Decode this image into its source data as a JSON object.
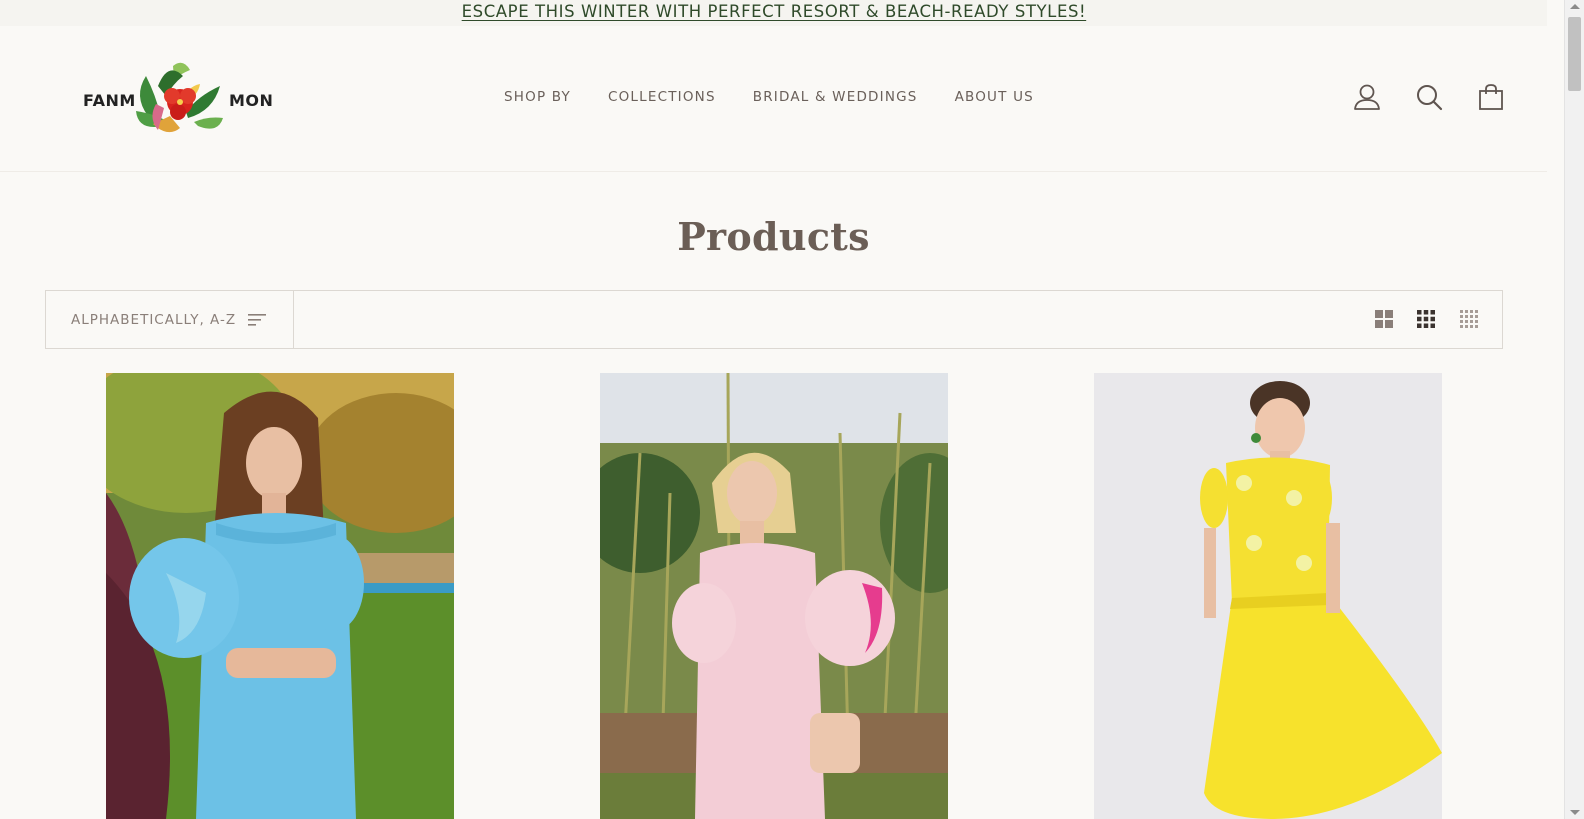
{
  "announcement": {
    "text": "ESCAPE THIS WINTER WITH PERFECT RESORT & BEACH-READY STYLES!"
  },
  "brand": {
    "left": "FANM",
    "right": "MON"
  },
  "nav": [
    {
      "label": "SHOP BY"
    },
    {
      "label": "COLLECTIONS"
    },
    {
      "label": "BRIDAL & WEDDINGS"
    },
    {
      "label": "ABOUT US"
    }
  ],
  "header_icons": [
    "account-icon",
    "search-icon",
    "cart-icon"
  ],
  "page": {
    "title": "Products"
  },
  "toolbar": {
    "sort_label": "ALPHABETICALLY, A-Z",
    "grid_options": [
      "grid-2-icon",
      "grid-3-icon",
      "grid-4-icon"
    ],
    "active_grid": "grid-3-icon"
  },
  "products": [
    {
      "dress_color": "#6cc1e6",
      "description_icon": "blue-dress-photo"
    },
    {
      "dress_color": "#f3cdd6",
      "description_icon": "pink-dress-photo"
    },
    {
      "dress_color": "#f7e22c",
      "description_icon": "yellow-dress-photo"
    }
  ],
  "colors": {
    "background": "#faf9f6",
    "text": "#6b5e56",
    "announcement_text": "#2f4a2a"
  }
}
